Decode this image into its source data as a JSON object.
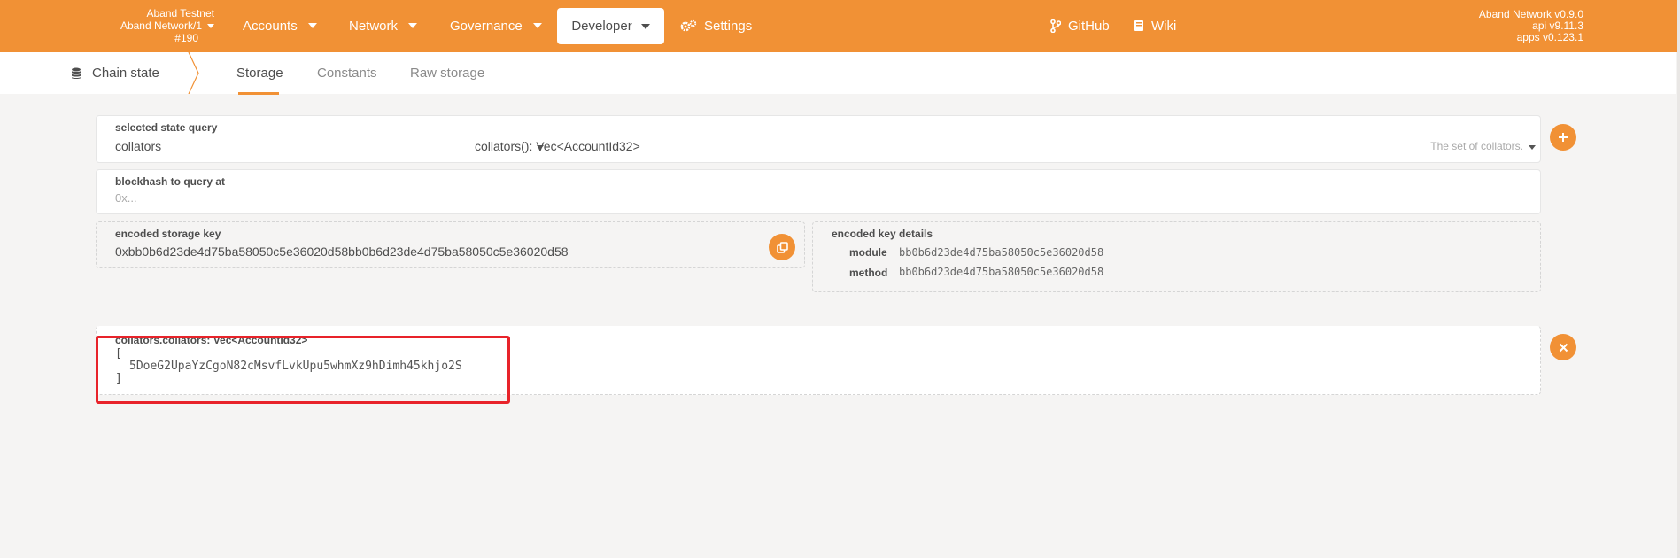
{
  "header": {
    "chain_name": "Aband Testnet",
    "network_name": "Aband Network/1",
    "block": "#190",
    "nav": {
      "accounts": "Accounts",
      "network": "Network",
      "governance": "Governance",
      "developer": "Developer",
      "settings": "Settings",
      "github": "GitHub",
      "wiki": "Wiki"
    },
    "versions": {
      "node": "Aband Network v0.9.0",
      "api": "api v9.11.3",
      "apps": "apps v0.123.1"
    }
  },
  "subnav": {
    "section": "Chain state",
    "tabs": [
      "Storage",
      "Constants",
      "Raw storage"
    ],
    "active_tab": "Storage"
  },
  "query": {
    "selected_label": "selected state query",
    "module": "collators",
    "method_signature": "collators(): Vec<AccountId32>",
    "description": "The set of collators."
  },
  "blockhash": {
    "label": "blockhash to query at",
    "placeholder": "0x..."
  },
  "storage_key": {
    "label": "encoded storage key",
    "value": "0xbb0b6d23de4d75ba58050c5e36020d58bb0b6d23de4d75ba58050c5e36020d58"
  },
  "key_details": {
    "label": "encoded key details",
    "module_label": "module",
    "module_value": "bb0b6d23de4d75ba58050c5e36020d58",
    "method_label": "method",
    "method_value": "bb0b6d23de4d75ba58050c5e36020d58"
  },
  "result": {
    "label": "collators.collators: Vec<AccountId32>",
    "open_bracket": "[",
    "item": "5DoeG2UpaYzCgoN82cMsvfLvkUpu5whmXz9hDimh45khjo2S",
    "close_bracket": "]"
  },
  "colors": {
    "accent": "#f19135",
    "highlight_border": "#e8232a"
  }
}
